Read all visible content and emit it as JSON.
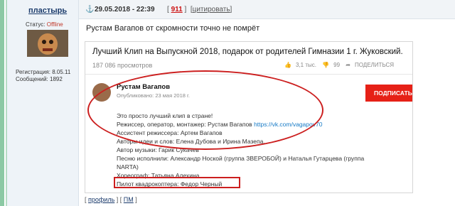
{
  "user": {
    "name": "пластырь",
    "status_label": "Статус:",
    "status_value": "Offline",
    "registration": "Регистрация: 8.05.11",
    "messages": "Сообщений: 1892"
  },
  "post": {
    "anchor_icon": "⚓",
    "datetime": "29.05.2018 - 22:39",
    "rating_open": "[",
    "rating": "911",
    "rating_close": "]",
    "quote_label": "цитировать",
    "comment": "Рустам Вагапов от скромности точно не помрёт"
  },
  "video": {
    "title": "Лучший Клип на Выпускной 2018, подарок от родителей Гимназии 1 г. Жуковский.",
    "views": "187 086 просмотров",
    "likes": "3,1 тыс.",
    "dislikes": "99",
    "share": "ПОДЕЛИТЬСЯ",
    "channel": "Рустам Вагапов",
    "published": "Опубликовано: 23 мая 2018 г.",
    "subscribe": "ПОДПИСАТЬ",
    "desc": [
      "Это просто лучший клип в стране!",
      "Режиссер, оператор, монтажер: Рустам Вагапов",
      "Ассистент режиссера: Артем Вагапов",
      "Авторы идеи и слов: Елена Дубова и Ирина Мазепа.",
      "Автор музыки: Гарик Сукачев",
      "Песню исполнили: Александр Ноской (группа ЗВЕРОБОЙ) и Наталья Гутарцева (группа",
      "NARTA)",
      "Хореограф: Татьяна Алехина",
      "Пилот квадрокоптера: Федор Черный"
    ],
    "desc_link": "https://vk.com/vagapov70"
  },
  "footer": {
    "profile": "профиль",
    "pm": "ПМ"
  },
  "colors": {
    "accent_red": "#cc1f1f",
    "subscribe_red": "#e62117",
    "link_blue": "#167ac6"
  }
}
